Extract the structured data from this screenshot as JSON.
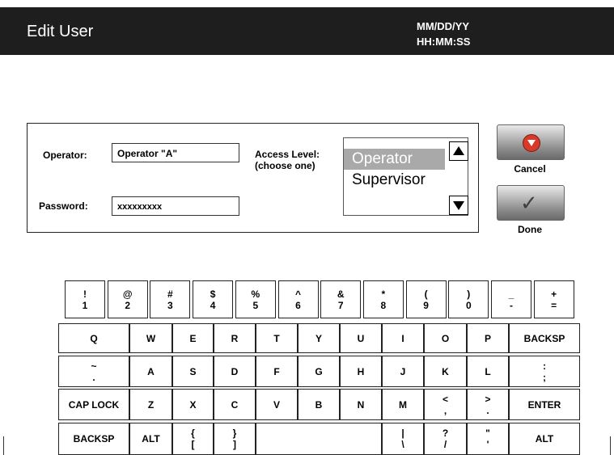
{
  "header": {
    "title": "Edit User",
    "date": "MM/DD/YY",
    "time": "HH:MM:SS"
  },
  "form": {
    "operator_label": "Operator:",
    "operator_value": "Operator \"A\"",
    "password_label": "Password:",
    "password_value": "xxxxxxxxx",
    "access_label_1": "Access Level:",
    "access_label_2": "(choose one)",
    "access_options": [
      "Operator",
      "Supervisor"
    ],
    "access_selected": "Operator"
  },
  "buttons": {
    "cancel": "Cancel",
    "done": "Done"
  },
  "keyboard": {
    "row1": [
      [
        "!",
        "1"
      ],
      [
        "@",
        "2"
      ],
      [
        "#",
        "3"
      ],
      [
        "$",
        "4"
      ],
      [
        "%",
        "5"
      ],
      [
        "^",
        "6"
      ],
      [
        "&",
        "7"
      ],
      [
        "*",
        "8"
      ],
      [
        "(",
        "9"
      ],
      [
        ")",
        "0"
      ],
      [
        "_",
        "-"
      ],
      [
        "+",
        "="
      ]
    ],
    "row2": [
      "Q",
      "W",
      "E",
      "R",
      "T",
      "Y",
      "U",
      "I",
      "O",
      "P",
      "BACKSP"
    ],
    "row3": [
      [
        "~",
        "."
      ],
      "A",
      "S",
      "D",
      "F",
      "G",
      "H",
      "J",
      [
        "K"
      ],
      "L",
      [
        ":",
        ";"
      ]
    ],
    "row4": [
      "CAP LOCK",
      "Z",
      "X",
      "C",
      "V",
      "B",
      "N",
      "M",
      [
        "<",
        ","
      ],
      [
        ">",
        "."
      ],
      "ENTER"
    ],
    "row5": [
      "BACKSP",
      "ALT",
      [
        "{",
        "["
      ],
      [
        "}",
        "]"
      ],
      "",
      [
        "|",
        "\\"
      ],
      [
        "?",
        "/"
      ],
      [
        "\"",
        "'"
      ],
      "ALT"
    ]
  },
  "colors": {
    "titlebar": "#1e1e1e",
    "selected_option": "#a9a9a9",
    "cancel_icon": "#d83a2a"
  }
}
